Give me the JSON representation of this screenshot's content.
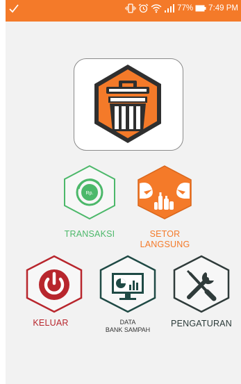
{
  "status_bar": {
    "battery_percent": "77%",
    "time": "7:49 PM",
    "icons": [
      "check-icon",
      "vibrate-icon",
      "alarm-icon",
      "wifi-icon",
      "signal-icon",
      "battery-icon"
    ]
  },
  "app": {
    "logo_icon": "trash-bin-icon",
    "colors": {
      "accent": "#f47a29",
      "green": "#4cb86a",
      "red": "#b8262d",
      "dark_teal": "#1f4a45",
      "dark": "#2f3b3a"
    }
  },
  "menu": {
    "transaksi": {
      "label": "TRANSAKSI",
      "badge": "Rp.",
      "icon": "money-refresh-icon"
    },
    "setor_langsung": {
      "label_line1": "SETOR",
      "label_line2": "LANGSUNG",
      "icon": "bottles-exchange-icon"
    },
    "keluar": {
      "label": "KELUAR",
      "icon": "power-icon"
    },
    "data_bank_sampah": {
      "label_line1": "DATA",
      "label_line2": "BANK SAMPAH",
      "icon": "monitor-chart-icon"
    },
    "pengaturan": {
      "label": "PENGATURAN",
      "icon": "tools-icon"
    }
  }
}
